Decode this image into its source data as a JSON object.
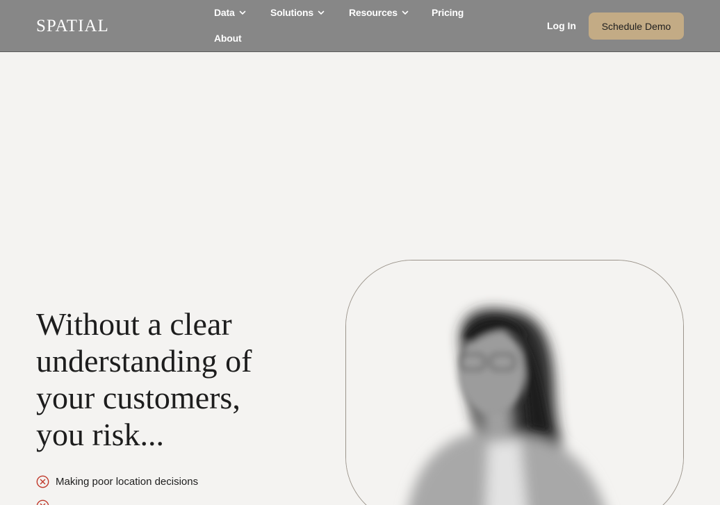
{
  "header": {
    "logo": "SPATIAL",
    "nav": [
      {
        "label": "Data",
        "has_dropdown": true
      },
      {
        "label": "Solutions",
        "has_dropdown": true
      },
      {
        "label": "Resources",
        "has_dropdown": true
      },
      {
        "label": "Pricing",
        "has_dropdown": false
      },
      {
        "label": "About",
        "has_dropdown": false
      }
    ],
    "login_label": "Log In",
    "demo_label": "Schedule Demo"
  },
  "hero": {
    "headline_lines": [
      "Without a clear",
      "understanding of",
      "your customers,",
      "you risk..."
    ],
    "risks": [
      "Making poor location decisions",
      ""
    ]
  },
  "colors": {
    "header_bg": "#878787",
    "page_bg": "#f4f3f1",
    "accent_button": "#c3ab85",
    "risk_icon": "#c0392b"
  },
  "icons": {
    "dropdown": "chevron-down-icon",
    "risk": "x-circle-icon"
  }
}
